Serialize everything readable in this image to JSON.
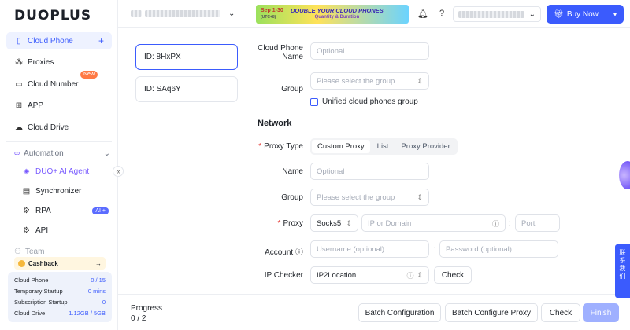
{
  "app": {
    "logo": "DUOPLUS"
  },
  "sidebar": {
    "items": [
      {
        "label": "Cloud Phone",
        "icon": "phone-icon"
      },
      {
        "label": "Proxies",
        "icon": "network-icon"
      },
      {
        "label": "Cloud Number",
        "icon": "number-icon",
        "badge": "New"
      },
      {
        "label": "APP",
        "icon": "app-grid-icon"
      },
      {
        "label": "Cloud Drive",
        "icon": "cloud-icon"
      }
    ],
    "automation": {
      "label": "Automation",
      "items": [
        {
          "label": "DUO+ AI Agent"
        },
        {
          "label": "Synchronizer"
        },
        {
          "label": "RPA",
          "badge": "AI +"
        },
        {
          "label": "API"
        }
      ]
    },
    "team_label": "Team",
    "cashback": {
      "label": "Cashback",
      "arrow": "→"
    },
    "usage": [
      {
        "label": "Cloud Phone",
        "value": "0 / 15"
      },
      {
        "label": "Temporary Startup",
        "value": "0 mins"
      },
      {
        "label": "Subscription Startup",
        "value": "0"
      },
      {
        "label": "Cloud Drive",
        "value": "1.12GB / 5GB"
      }
    ]
  },
  "header": {
    "banner_date": "Sep 1-30",
    "banner_tz": "(UTC+8)",
    "banner_title": "DOUBLE YOUR CLOUD PHONES",
    "banner_sub": "Quantity & Duration",
    "buy_now": "Buy Now"
  },
  "phones": [
    {
      "label": "ID: 8HxPX"
    },
    {
      "label": "ID: SAq6Y"
    }
  ],
  "form": {
    "name_label": "Cloud Phone Name",
    "name_placeholder": "Optional",
    "group_label": "Group",
    "group_placeholder": "Please select the group",
    "unified_label": "Unified cloud phones group",
    "network_title": "Network",
    "proxy_type_label": "Proxy Type",
    "proxy_types": [
      "Custom Proxy",
      "List",
      "Proxy Provider"
    ],
    "net_name_label": "Name",
    "net_name_placeholder": "Optional",
    "net_group_label": "Group",
    "net_group_placeholder": "Please select the group",
    "proxy_label": "Proxy",
    "proxy_protocol": "Socks5",
    "host_placeholder": "IP or Domain",
    "port_placeholder": "Port",
    "account_label": "Account",
    "username_placeholder": "Username (optional)",
    "password_placeholder": "Password (optional)",
    "checker_label": "IP Checker",
    "checker_value": "IP2Location",
    "check_button": "Check"
  },
  "footer": {
    "progress_label": "Progress",
    "progress_value": "0 / 2",
    "batch_config": "Batch Configuration",
    "batch_proxy": "Batch Configure Proxy",
    "check": "Check",
    "finish": "Finish"
  },
  "side_contact": "联系我们",
  "colors": {
    "accent": "#3b5bfd",
    "required": "#e53935"
  }
}
